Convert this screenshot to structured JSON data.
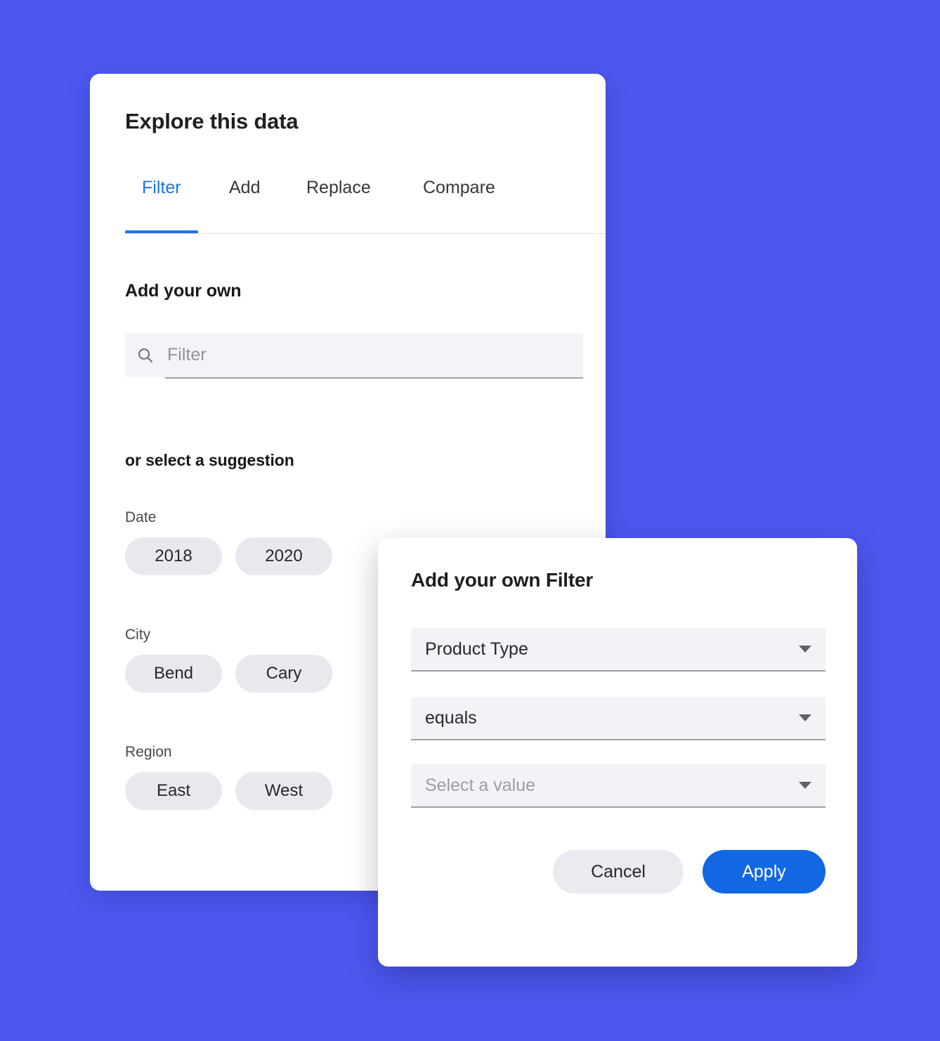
{
  "theme": {
    "background": "#4d57f0",
    "accent": "#1a73e8",
    "primary_button": "#1267e4",
    "chip_background": "#e7e9ee",
    "field_background": "#f1f3f6"
  },
  "explore_panel": {
    "title": "Explore this data",
    "tabs": [
      {
        "label": "Filter",
        "active": true
      },
      {
        "label": "Add",
        "active": false
      },
      {
        "label": "Replace",
        "active": false
      },
      {
        "label": "Compare",
        "active": false
      }
    ],
    "add_your_own": {
      "heading": "Add your own",
      "search_icon": "search-icon",
      "search_placeholder": "Filter",
      "search_value": ""
    },
    "suggestions": {
      "heading": "or select a suggestion",
      "groups": [
        {
          "label": "Date",
          "chips": [
            "2018",
            "2020"
          ]
        },
        {
          "label": "City",
          "chips": [
            "Bend",
            "Cary"
          ]
        },
        {
          "label": "Region",
          "chips": [
            "East",
            "West"
          ]
        }
      ]
    }
  },
  "filter_dialog": {
    "title": "Add your own Filter",
    "fields": [
      {
        "name": "field",
        "value": "Product Type",
        "is_placeholder": false,
        "icon": "chevron-down-icon"
      },
      {
        "name": "operator",
        "value": "equals",
        "is_placeholder": false,
        "icon": "chevron-down-icon"
      },
      {
        "name": "value",
        "value": "Select a value",
        "is_placeholder": true,
        "icon": "chevron-down-icon"
      }
    ],
    "cancel_label": "Cancel",
    "apply_label": "Apply"
  }
}
